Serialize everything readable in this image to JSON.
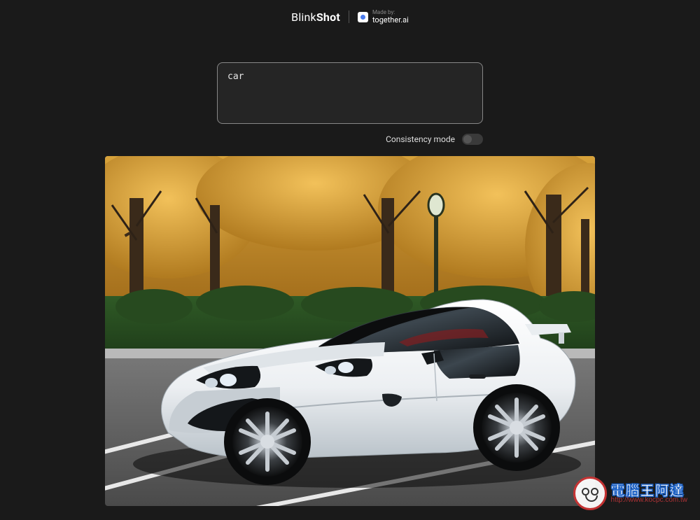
{
  "header": {
    "logo_prefix": "Blink",
    "logo_suffix": "Shot",
    "made_by_label": "Made by:",
    "brand": "together.ai"
  },
  "prompt": {
    "value": "car",
    "placeholder": ""
  },
  "controls": {
    "consistency_label": "Consistency mode",
    "consistency_on": false
  },
  "watermark": {
    "title": "電腦王阿達",
    "url": "http://www.kocpc.com.tw"
  },
  "generated_image": {
    "description": "white sports car on road with autumn trees and hedge"
  }
}
